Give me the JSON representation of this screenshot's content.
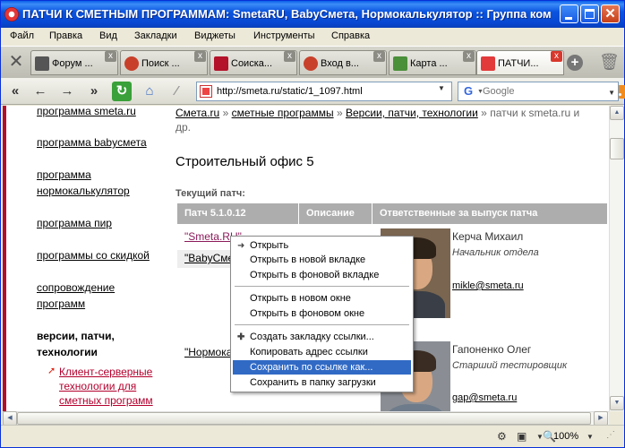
{
  "window": {
    "title": "ПАТЧИ К СМЕТНЫМ ПРОГРАММАМ: SmetaRU, BabyСмета, Нормокалькулятор :: Группа комп..."
  },
  "menu": [
    "Файл",
    "Правка",
    "Вид",
    "Закладки",
    "Виджеты",
    "Инструменты",
    "Справка"
  ],
  "tabs": [
    {
      "label": "Форум ...",
      "close": "x"
    },
    {
      "label": "Поиск ...",
      "close": "x"
    },
    {
      "label": "Соиска...",
      "close": "x"
    },
    {
      "label": "Вход в...",
      "close": "x"
    },
    {
      "label": "Карта ...",
      "close": "x"
    },
    {
      "label": "ПАТЧИ...",
      "close": "x"
    }
  ],
  "nav": {
    "url": "http://smeta.ru/static/1_1097.html",
    "search_placeholder": "Google",
    "search_engine_icon": "G"
  },
  "sidebar": {
    "items": [
      {
        "label": "программа smeta.ru"
      },
      {
        "label": "программа babyсмета"
      },
      {
        "label": "программа"
      },
      {
        "label": "нормокалькулятор"
      },
      {
        "label": "программа пир"
      },
      {
        "label": "программы со скидкой"
      },
      {
        "label": "сопровождение"
      },
      {
        "label": "программ"
      },
      {
        "label": "версии, патчи,"
      },
      {
        "label": "технологии"
      }
    ],
    "sub_items": [
      {
        "label": "Клиент-серверные"
      },
      {
        "label": "технологии для"
      },
      {
        "label": "сметных программ"
      }
    ]
  },
  "breadcrumb": {
    "items": [
      "Смета.ru",
      "сметные программы",
      "Версии, патчи, технологии"
    ],
    "separator": "»",
    "current": "патчи к smeta.ru и",
    "current_cont": "др."
  },
  "content": {
    "heading": "Строительный офис 5",
    "current_patch_label": "Текущий патч:",
    "table_headers": [
      "Патч 5.1.0.12",
      "Описание",
      "Ответственные за выпуск патча"
    ],
    "rows": [
      {
        "link": "\"Smeta.RU\""
      },
      {
        "link": "\"BabyСме"
      },
      {
        "link": "\"Нормока"
      }
    ],
    "people": [
      {
        "name": "Керча Михаил",
        "role": "Начальник отдела",
        "email": "mikle@smeta.ru"
      },
      {
        "name": "Гапоненко Олег",
        "role": "Старший тестировщик",
        "email": "gap@smeta.ru"
      }
    ]
  },
  "context_menu": {
    "items": [
      {
        "label": "Открыть",
        "icon": "arrow-right-icon"
      },
      {
        "label": "Открыть в новой вкладке"
      },
      {
        "label": "Открыть в фоновой вкладке"
      },
      {
        "label": "Открыть в новом окне"
      },
      {
        "label": "Открыть в фоновом окне"
      },
      {
        "label": "Создать закладку ссылки...",
        "icon": "plus-icon"
      },
      {
        "label": "Копировать адрес ссылки"
      },
      {
        "label": "Сохранить по ссылке как..."
      },
      {
        "label": "Сохранить в папку загрузки"
      }
    ],
    "highlighted": "Сохранить по ссылке как..."
  },
  "status": {
    "zoom": "100%"
  },
  "colors": {
    "accent": "#316ac5",
    "sidebar_line": "#b30d2c",
    "table_header": "#adadad",
    "titlebar": "#0b55df"
  }
}
